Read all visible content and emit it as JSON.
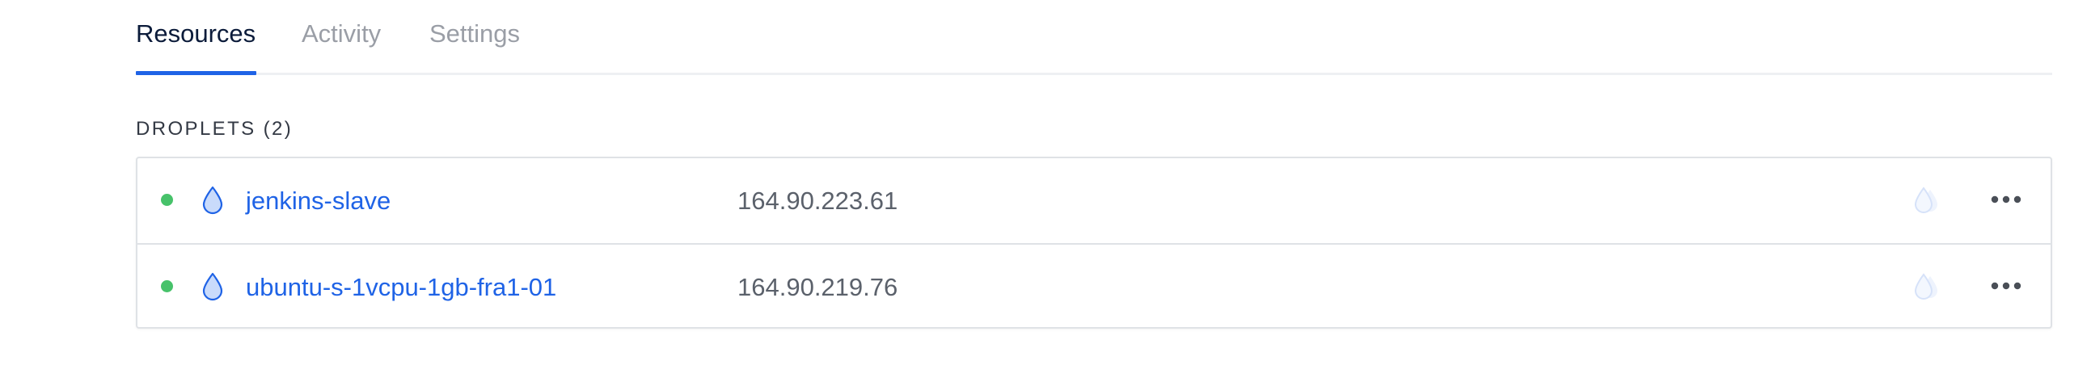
{
  "tabs": [
    {
      "label": "Resources",
      "active": true
    },
    {
      "label": "Activity",
      "active": false
    },
    {
      "label": "Settings",
      "active": false
    }
  ],
  "section": {
    "heading": "DROPLETS (2)"
  },
  "droplets": [
    {
      "status": "active",
      "name": "jenkins-slave",
      "ip": "164.90.223.61"
    },
    {
      "status": "active",
      "name": "ubuntu-s-1vcpu-1gb-fra1-01",
      "ip": "164.90.219.76"
    }
  ],
  "icons": {
    "status": "status-dot-icon",
    "droplet": "droplet-icon",
    "faded": "faded-droplet-icon",
    "more": "more-horizontal-icon"
  },
  "colors": {
    "accent": "#1f63e6",
    "status_active": "#47c26a",
    "tab_active": "#0b1b3a",
    "tab_inactive": "#9a9ea6",
    "ip_text": "#5b616b",
    "border": "#dfe2e6"
  }
}
